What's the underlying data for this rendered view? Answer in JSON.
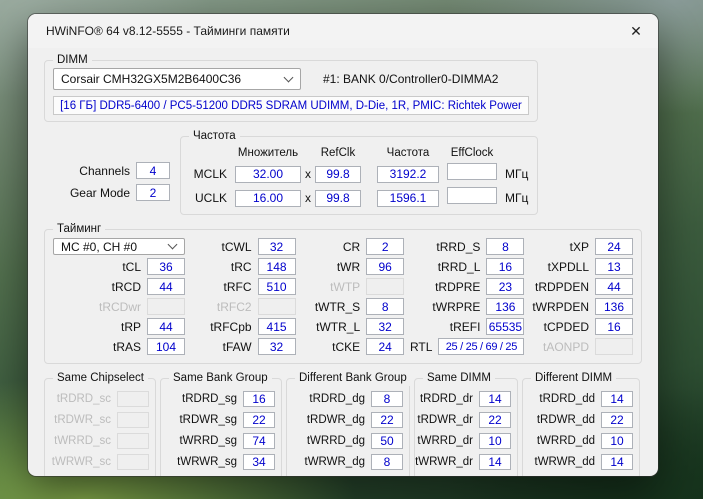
{
  "colors": {
    "accent_blue": "#0000cc",
    "window_bg": "#f0f0f0"
  },
  "window": {
    "title": "HWiNFO® 64 v8.12-5555 - Тайминги памяти",
    "close_glyph": "✕"
  },
  "dimm": {
    "label": "DIMM",
    "combo_value": "Corsair CMH32GX5M2B6400C36",
    "slot": "#1: BANK 0/Controller0-DIMMA2",
    "info": "[16 ГБ] DDR5-6400 / PC5-51200 DDR5 SDRAM UDIMM, D-Die, 1R, PMIC: Richtek Power"
  },
  "left_fields": [
    {
      "label": "Channels",
      "value": "4"
    },
    {
      "label": "Gear Mode",
      "value": "2"
    }
  ],
  "frequency": {
    "label": "Частота",
    "headers": [
      "Множитель",
      "RefClk",
      "Частота",
      "EffClock"
    ],
    "mult_sign": "x",
    "unit": "МГц",
    "rows": [
      {
        "label": "MCLK",
        "mult": "32.00",
        "refclk": "99.8",
        "freq": "3192.2",
        "eff": ""
      },
      {
        "label": "UCLK",
        "mult": "16.00",
        "refclk": "99.8",
        "freq": "1596.1",
        "eff": ""
      }
    ]
  },
  "timing": {
    "label": "Тайминг",
    "combo_value": "MC #0, CH #0",
    "columns": [
      {
        "cells": [
          {
            "label": "tCL",
            "value": "36"
          },
          {
            "label": "tRCD",
            "value": "44"
          },
          {
            "label": "tRCDwr",
            "value": "",
            "disabled": true
          },
          {
            "label": "tRP",
            "value": "44"
          },
          {
            "label": "tRAS",
            "value": "104"
          }
        ]
      },
      {
        "cells": [
          {
            "label": "tCWL",
            "value": "32"
          },
          {
            "label": "tRC",
            "value": "148"
          },
          {
            "label": "tRFC",
            "value": "510"
          },
          {
            "label": "tRFC2",
            "value": "",
            "disabled": true
          },
          {
            "label": "tRFCpb",
            "value": "415"
          },
          {
            "label": "tFAW",
            "value": "32"
          }
        ]
      },
      {
        "cells": [
          {
            "label": "CR",
            "value": "2"
          },
          {
            "label": "tWR",
            "value": "96"
          },
          {
            "label": "tWTP",
            "value": "",
            "disabled": true
          },
          {
            "label": "tWTR_S",
            "value": "8"
          },
          {
            "label": "tWTR_L",
            "value": "32"
          },
          {
            "label": "tCKE",
            "value": "24"
          }
        ]
      },
      {
        "cells": [
          {
            "label": "tRRD_S",
            "value": "8"
          },
          {
            "label": "tRRD_L",
            "value": "16"
          },
          {
            "label": "tRDPRE",
            "value": "23"
          },
          {
            "label": "tWRPRE",
            "value": "136"
          },
          {
            "label": "tREFI",
            "value": "65535"
          },
          {
            "label": "RTL",
            "value": "25 / 25 / 69 / 25"
          }
        ]
      },
      {
        "cells": [
          {
            "label": "tXP",
            "value": "24"
          },
          {
            "label": "tXPDLL",
            "value": "13"
          },
          {
            "label": "tRDPDEN",
            "value": "44"
          },
          {
            "label": "tWRPDEN",
            "value": "136"
          },
          {
            "label": "tCPDED",
            "value": "16"
          },
          {
            "label": "tAONPD",
            "value": "",
            "disabled": true
          }
        ]
      }
    ]
  },
  "bottom_groups": [
    {
      "title": "Same Chipselect",
      "rows": [
        {
          "label": "tRDRD_sc",
          "value": "",
          "disabled": true
        },
        {
          "label": "tRDWR_sc",
          "value": "",
          "disabled": true
        },
        {
          "label": "tWRRD_sc",
          "value": "",
          "disabled": true
        },
        {
          "label": "tWRWR_sc",
          "value": "",
          "disabled": true
        }
      ]
    },
    {
      "title": "Same Bank Group",
      "rows": [
        {
          "label": "tRDRD_sg",
          "value": "16"
        },
        {
          "label": "tRDWR_sg",
          "value": "22"
        },
        {
          "label": "tWRRD_sg",
          "value": "74"
        },
        {
          "label": "tWRWR_sg",
          "value": "34"
        }
      ]
    },
    {
      "title": "Different Bank Group",
      "rows": [
        {
          "label": "tRDRD_dg",
          "value": "8"
        },
        {
          "label": "tRDWR_dg",
          "value": "22"
        },
        {
          "label": "tWRRD_dg",
          "value": "50"
        },
        {
          "label": "tWRWR_dg",
          "value": "8"
        }
      ]
    },
    {
      "title": "Same DIMM",
      "rows": [
        {
          "label": "tRDRD_dr",
          "value": "14"
        },
        {
          "label": "tRDWR_dr",
          "value": "22"
        },
        {
          "label": "tWRRD_dr",
          "value": "10"
        },
        {
          "label": "tWRWR_dr",
          "value": "14"
        }
      ]
    },
    {
      "title": "Different DIMM",
      "rows": [
        {
          "label": "tRDRD_dd",
          "value": "14"
        },
        {
          "label": "tRDWR_dd",
          "value": "22"
        },
        {
          "label": "tWRRD_dd",
          "value": "10"
        },
        {
          "label": "tWRWR_dd",
          "value": "14"
        }
      ]
    }
  ]
}
